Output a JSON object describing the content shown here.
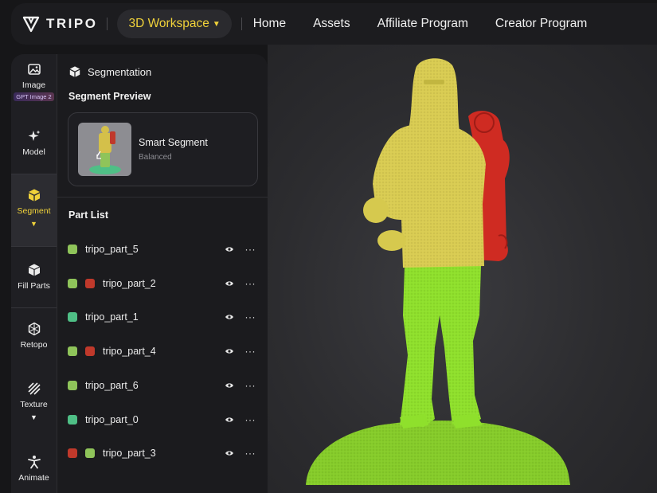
{
  "brand": {
    "name": "TRIPO",
    "accent": "#f0d23a"
  },
  "topnav": {
    "workspace_label": "3D Workspace",
    "links": [
      "Home",
      "Assets",
      "Affiliate Program",
      "Creator Program"
    ]
  },
  "leftrail": {
    "items": [
      {
        "label": "Image",
        "icon": "image-icon",
        "badge": "GPT Image 2"
      },
      {
        "label": "Model",
        "icon": "sparkle-icon"
      },
      {
        "label": "Segment",
        "icon": "segment-cube-icon",
        "active": true
      },
      {
        "label": "Fill Parts",
        "icon": "cube-icon"
      },
      {
        "label": "Retopo",
        "icon": "retopo-icon"
      },
      {
        "label": "Texture",
        "icon": "texture-icon"
      },
      {
        "label": "Animate",
        "icon": "figure-icon"
      }
    ]
  },
  "panel": {
    "title": "Segmentation",
    "preview_heading": "Segment Preview",
    "preview_card": {
      "title": "Smart Segment",
      "subtitle": "Balanced"
    },
    "part_list_heading": "Part List",
    "parts": [
      {
        "name": "tripo_part_5",
        "colors": [
          "#8fc45a"
        ]
      },
      {
        "name": "tripo_part_2",
        "colors": [
          "#8fc45a",
          "#c0392b"
        ]
      },
      {
        "name": "tripo_part_1",
        "colors": [
          "#4fbf86"
        ]
      },
      {
        "name": "tripo_part_4",
        "colors": [
          "#8fc45a",
          "#c0392b"
        ]
      },
      {
        "name": "tripo_part_6",
        "colors": [
          "#8fc45a"
        ]
      },
      {
        "name": "tripo_part_0",
        "colors": [
          "#4fbf86"
        ]
      },
      {
        "name": "tripo_part_3",
        "colors": [
          "#c0392b",
          "#8fc45a"
        ]
      }
    ]
  }
}
